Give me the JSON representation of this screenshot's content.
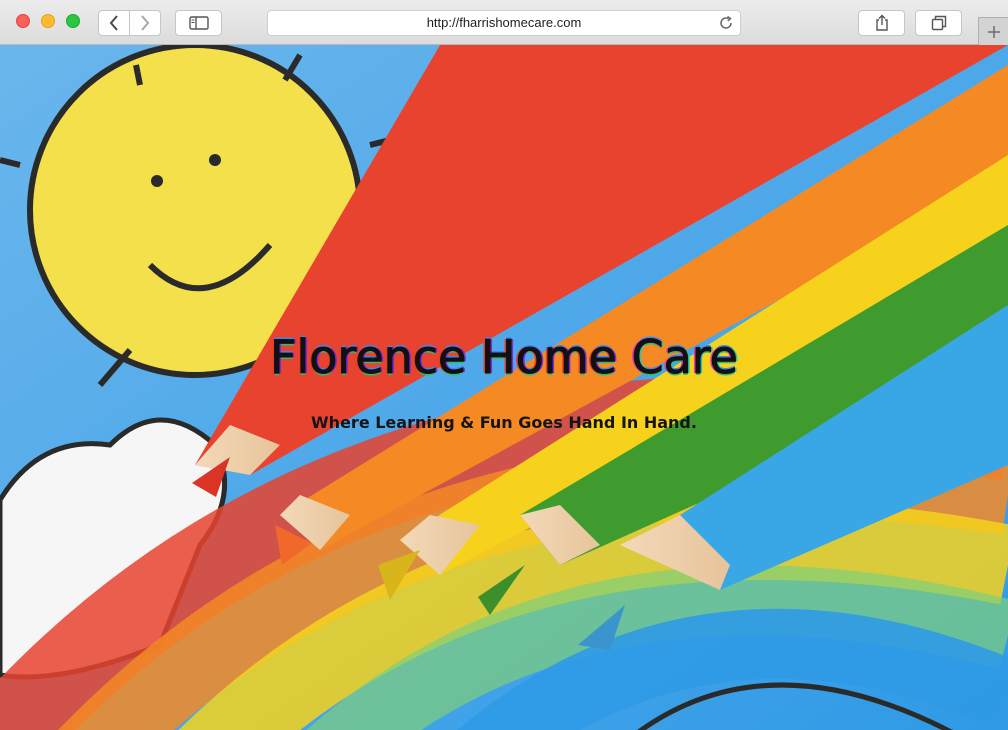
{
  "browser": {
    "url": "http://fharrishomecare.com",
    "icons": {
      "back": "chevron-left-icon",
      "forward": "chevron-right-icon",
      "sidebar": "sidebar-icon",
      "reload": "reload-icon",
      "share": "share-icon",
      "tabs": "tabs-overview-icon",
      "new_tab": "plus-icon"
    }
  },
  "site": {
    "title_part1": "Florence Home ",
    "title_part2": "Care",
    "tagline": "Where Learning & Fun Goes Hand In Hand."
  },
  "colors": {
    "red": "#e8432f",
    "orange": "#f58a24",
    "yellow": "#f6d21c",
    "green": "#3f9b2e",
    "blue": "#39a7e6",
    "sky": "#4aa6e8",
    "sun": "#f3e04a"
  }
}
